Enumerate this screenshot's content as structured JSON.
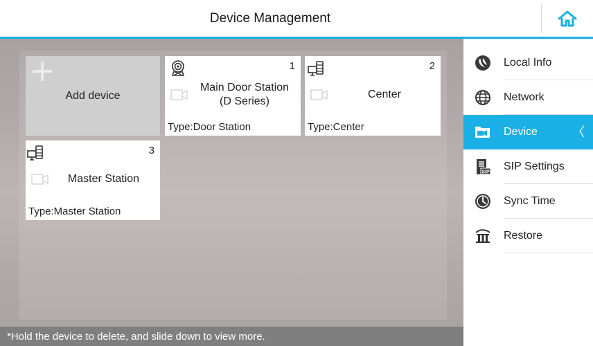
{
  "header": {
    "title": "Device Management",
    "home_icon": "home-icon",
    "accent_color": "#1ab0e6"
  },
  "main": {
    "add_tile": {
      "label": "Add device",
      "icon": "plus-icon"
    },
    "devices": [
      {
        "number": "1",
        "name_line1": "Main Door Station",
        "name_line2": "(D Series)",
        "type": "Type:Door Station",
        "icon": "door-station-icon"
      },
      {
        "number": "2",
        "name_line1": "Center",
        "name_line2": "",
        "type": "Type:Center",
        "icon": "monitor-station-icon"
      },
      {
        "number": "3",
        "name_line1": "Master Station",
        "name_line2": "",
        "type": "Type:Master Station",
        "icon": "monitor-station-icon"
      }
    ],
    "hint": "*Hold the device to delete, and slide down to view more."
  },
  "sidebar": {
    "active_index": 2,
    "items": [
      {
        "label": "Local Info",
        "icon": "local-info-icon"
      },
      {
        "label": "Network",
        "icon": "globe-icon"
      },
      {
        "label": "Device",
        "icon": "device-icon"
      },
      {
        "label": "SIP Settings",
        "icon": "sip-icon"
      },
      {
        "label": "Sync Time",
        "icon": "clock-icon"
      },
      {
        "label": "Restore",
        "icon": "restore-icon"
      }
    ],
    "active_chevron": "〈"
  }
}
